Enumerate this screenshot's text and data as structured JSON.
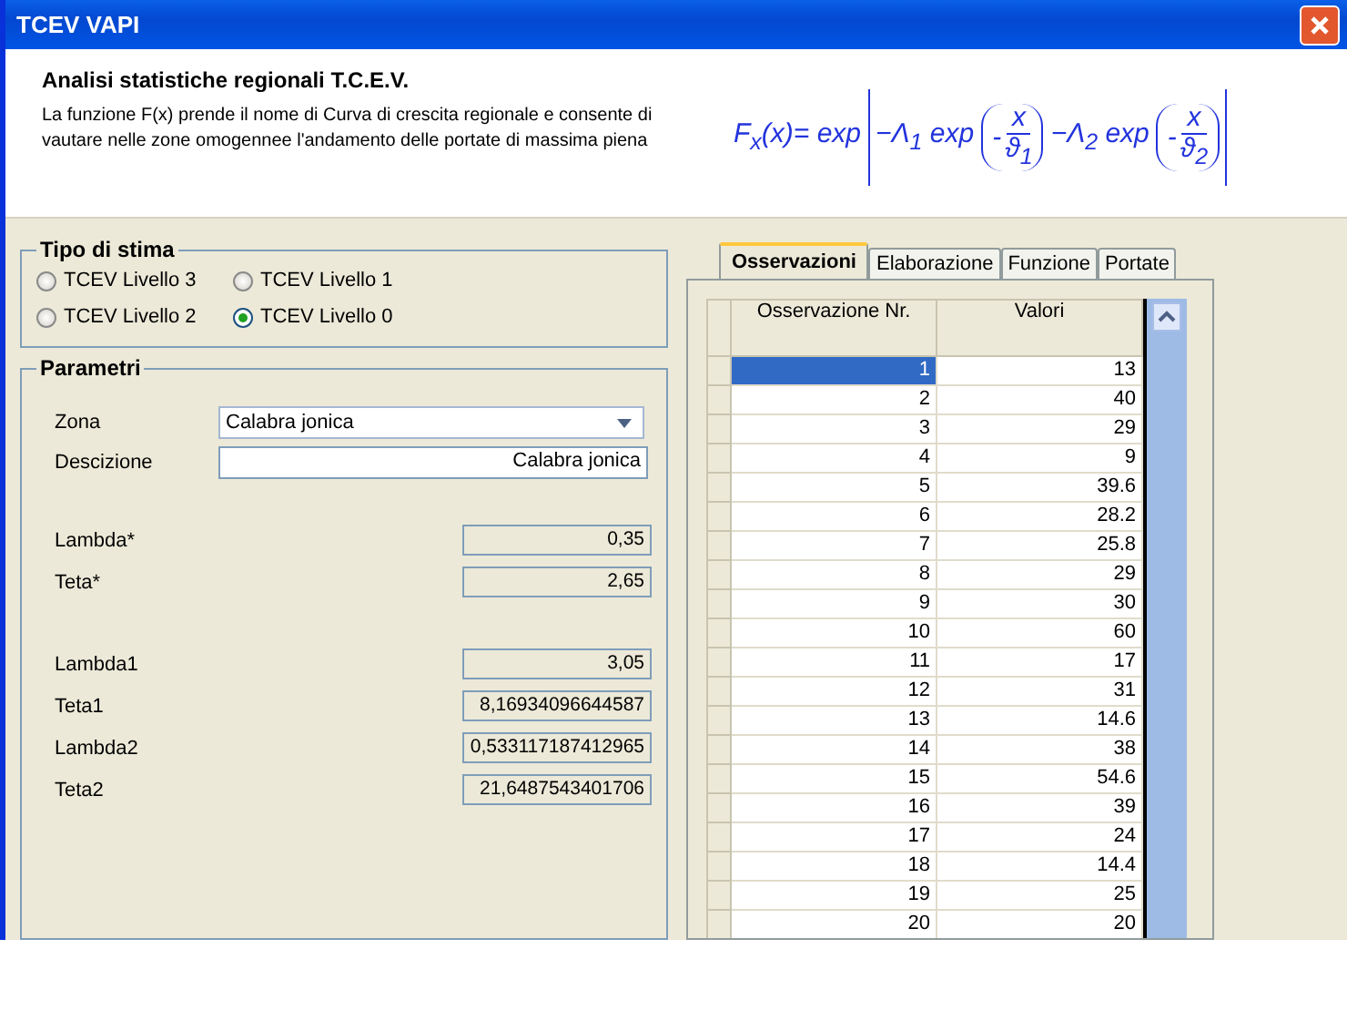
{
  "window": {
    "title": "TCEV VAPI"
  },
  "header": {
    "title": "Analisi statistiche regionali T.C.E.V.",
    "description": "La funzione F(x) prende il nome di Curva di crescita regionale e consente di vautare nelle zone omogennee l'andamento delle portate di massima piena"
  },
  "formula": {
    "lhs": "F$_{x}$(x)= exp",
    "term1": "−Λ$_{1}$ exp",
    "sign1": "-",
    "num1": "x",
    "den1": "ϑ$_{1}$",
    "term2": "−Λ$_{2}$ exp",
    "sign2": "-",
    "num2": "x",
    "den2": "ϑ$_{2}$"
  },
  "tipo_di_stima": {
    "title": "Tipo di stima",
    "options": [
      {
        "label": "TCEV Livello 3",
        "selected": false
      },
      {
        "label": "TCEV Livello 1",
        "selected": false
      },
      {
        "label": "TCEV Livello 2",
        "selected": false
      },
      {
        "label": "TCEV Livello 0",
        "selected": true
      }
    ]
  },
  "parametri": {
    "title": "Parametri",
    "zona": {
      "label": "Zona",
      "value": "Calabra jonica"
    },
    "descrizione": {
      "label": "Descizione",
      "value": "Calabra jonica"
    },
    "groups": [
      [
        {
          "label": "Lambda*",
          "value": "0,35"
        },
        {
          "label": "Teta*",
          "value": "2,65"
        }
      ],
      [
        {
          "label": "Lambda1",
          "value": "3,05"
        },
        {
          "label": "Teta1",
          "value": "8,16934096644587"
        },
        {
          "label": "Lambda2",
          "value": "0,533117187412965"
        },
        {
          "label": "Teta2",
          "value": "21,6487543401706"
        }
      ]
    ]
  },
  "tabs": [
    {
      "label": "Osservazioni",
      "selected": true
    },
    {
      "label": "Elaborazione",
      "selected": false
    },
    {
      "label": "Funzione",
      "selected": false
    },
    {
      "label": "Portate",
      "selected": false
    }
  ],
  "table": {
    "columns": [
      "Osservazione Nr.",
      "Valori"
    ],
    "rows": [
      {
        "cells": [
          "1",
          "13"
        ],
        "selected": true
      },
      {
        "cells": [
          "2",
          "40"
        ],
        "selected": false
      },
      {
        "cells": [
          "3",
          "29"
        ],
        "selected": false
      },
      {
        "cells": [
          "4",
          "9"
        ],
        "selected": false
      },
      {
        "cells": [
          "5",
          "39.6"
        ],
        "selected": false
      },
      {
        "cells": [
          "6",
          "28.2"
        ],
        "selected": false
      },
      {
        "cells": [
          "7",
          "25.8"
        ],
        "selected": false
      },
      {
        "cells": [
          "8",
          "29"
        ],
        "selected": false
      },
      {
        "cells": [
          "9",
          "30"
        ],
        "selected": false
      },
      {
        "cells": [
          "10",
          "60"
        ],
        "selected": false
      },
      {
        "cells": [
          "11",
          "17"
        ],
        "selected": false
      },
      {
        "cells": [
          "12",
          "31"
        ],
        "selected": false
      },
      {
        "cells": [
          "13",
          "14.6"
        ],
        "selected": false
      },
      {
        "cells": [
          "14",
          "38"
        ],
        "selected": false
      },
      {
        "cells": [
          "15",
          "54.6"
        ],
        "selected": false
      },
      {
        "cells": [
          "16",
          "39"
        ],
        "selected": false
      },
      {
        "cells": [
          "17",
          "24"
        ],
        "selected": false
      },
      {
        "cells": [
          "18",
          "14.4"
        ],
        "selected": false
      },
      {
        "cells": [
          "19",
          "25"
        ],
        "selected": false
      },
      {
        "cells": [
          "20",
          "20"
        ],
        "selected": false
      }
    ]
  }
}
